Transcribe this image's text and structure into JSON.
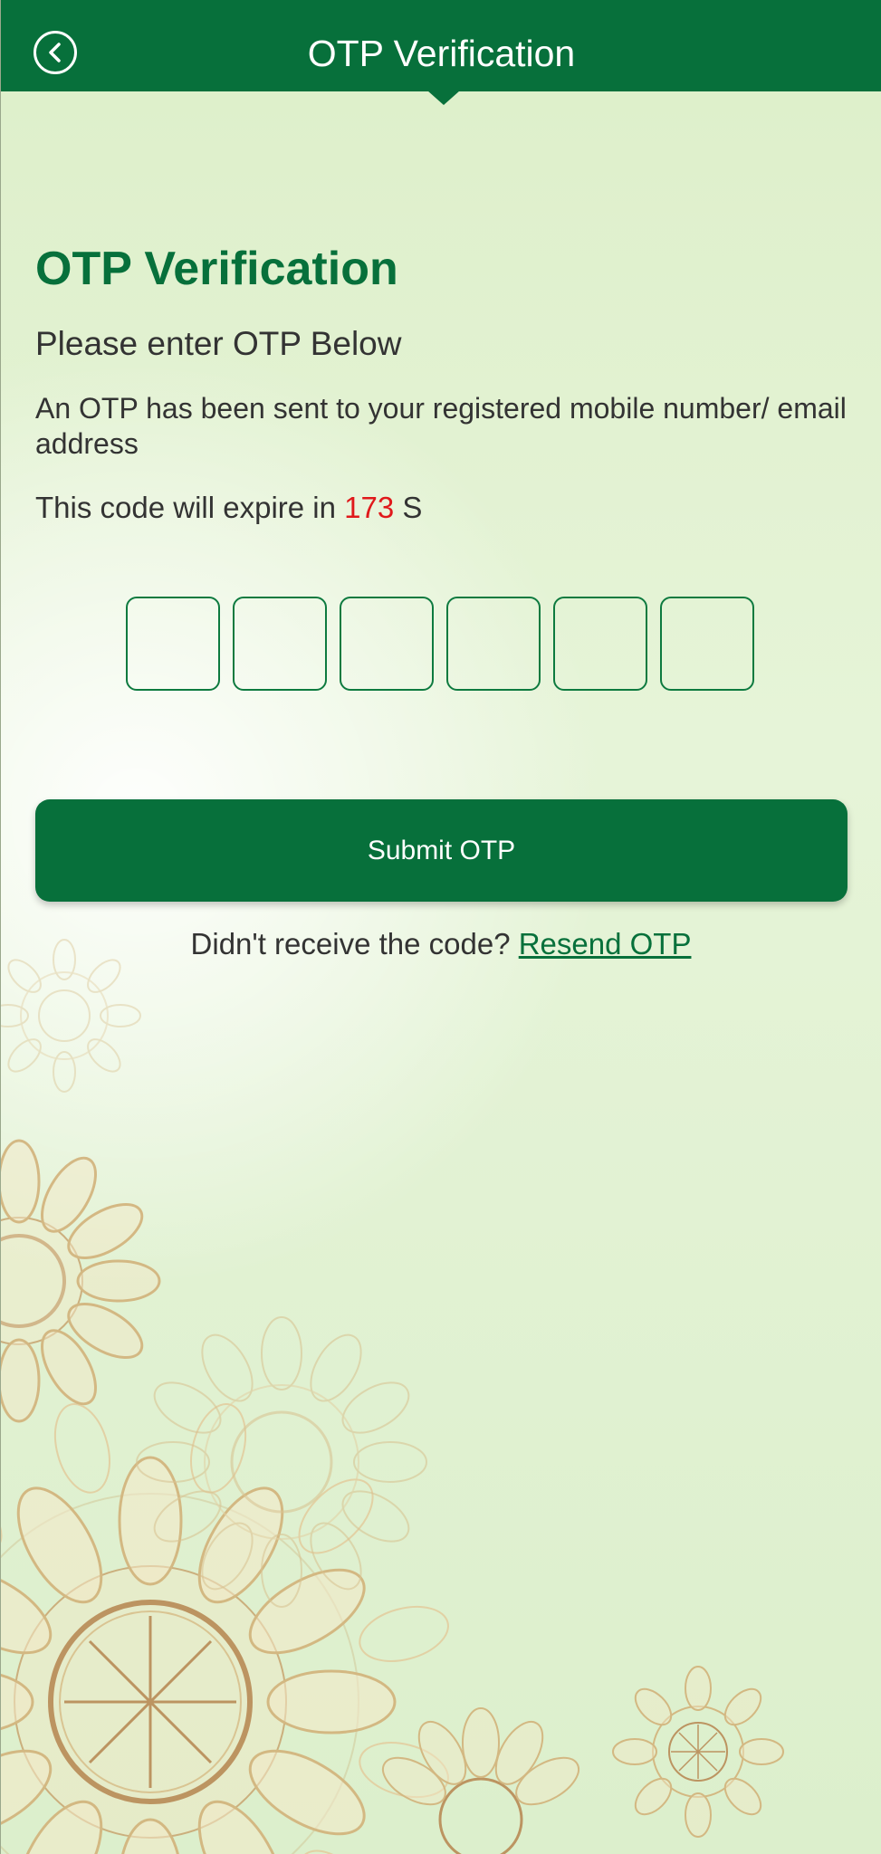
{
  "header": {
    "title": "OTP Verification",
    "back_icon": "back-arrow-circle-icon"
  },
  "main": {
    "heading": "OTP Verification",
    "subheading": "Please enter OTP Below",
    "info": "An OTP has been sent to your registered mobile number/ email address",
    "expiry_prefix": "This code will expire in",
    "expiry_seconds": "173",
    "expiry_suffix": "S",
    "otp_digits": [
      "",
      "",
      "",
      "",
      "",
      ""
    ],
    "submit_label": "Submit OTP",
    "resend_prompt": "Didn't receive the code?",
    "resend_label": "Resend OTP"
  },
  "colors": {
    "primary_green": "#07703b",
    "timer_red": "#e0191b",
    "background_light_green": "#e0f0d0",
    "ornament_gold": "#c9a874"
  }
}
